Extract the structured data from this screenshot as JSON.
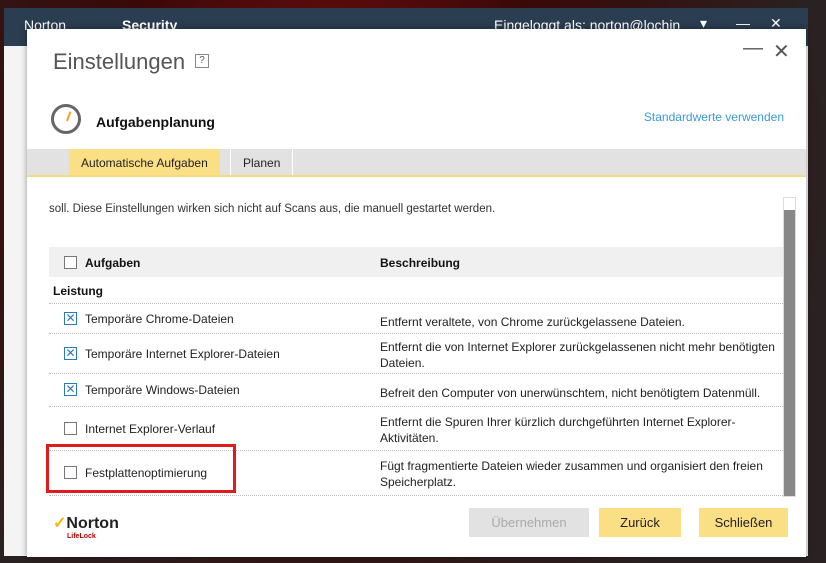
{
  "background_window": {
    "brand": "Norton",
    "product": "Security",
    "logged_in": "Eingeloggt als: norton@lochin"
  },
  "dialog": {
    "title": "Einstellungen",
    "help": "?",
    "section_title": "Aufgabenplanung",
    "defaults_link": "Standardwerte verwenden",
    "tabs": [
      {
        "label": "Automatische Aufgaben",
        "active": true
      },
      {
        "label": "Planen",
        "active": false
      }
    ],
    "intro": "soll. Diese Einstellungen wirken sich nicht auf Scans aus, die manuell gestartet werden.",
    "table": {
      "headers": {
        "tasks": "Aufgaben",
        "description": "Beschreibung"
      },
      "group": "Leistung",
      "rows": [
        {
          "name": "Temporäre Chrome-Dateien",
          "checked": true,
          "desc": "Entfernt veraltete, von Chrome zurückgelassene Dateien."
        },
        {
          "name": "Temporäre Internet Explorer-Dateien",
          "checked": true,
          "desc": "Entfernt die von Internet Explorer zurückgelassenen nicht mehr benötigten Dateien."
        },
        {
          "name": "Temporäre Windows-Dateien",
          "checked": true,
          "desc": "Befreit den Computer von unerwünschtem, nicht benötigtem Datenmüll."
        },
        {
          "name": "Internet Explorer-Verlauf",
          "checked": false,
          "desc": "Entfernt die Spuren Ihrer kürzlich durchgeführten Internet Explorer-Aktivitäten."
        },
        {
          "name": "Festplattenoptimierung",
          "checked": false,
          "desc": "Fügt fragmentierte Dateien wieder zusammen und organisiert den freien Speicherplatz."
        }
      ]
    },
    "buttons": {
      "apply": "Übernehmen",
      "back": "Zurück",
      "close": "Schließen"
    },
    "logo": {
      "brand": "Norton",
      "sub": "LifeLock"
    }
  },
  "colors": {
    "accent": "#fbdf85",
    "link": "#3a9ad9",
    "highlight": "#e01b1b",
    "header": "#2b3d50"
  }
}
